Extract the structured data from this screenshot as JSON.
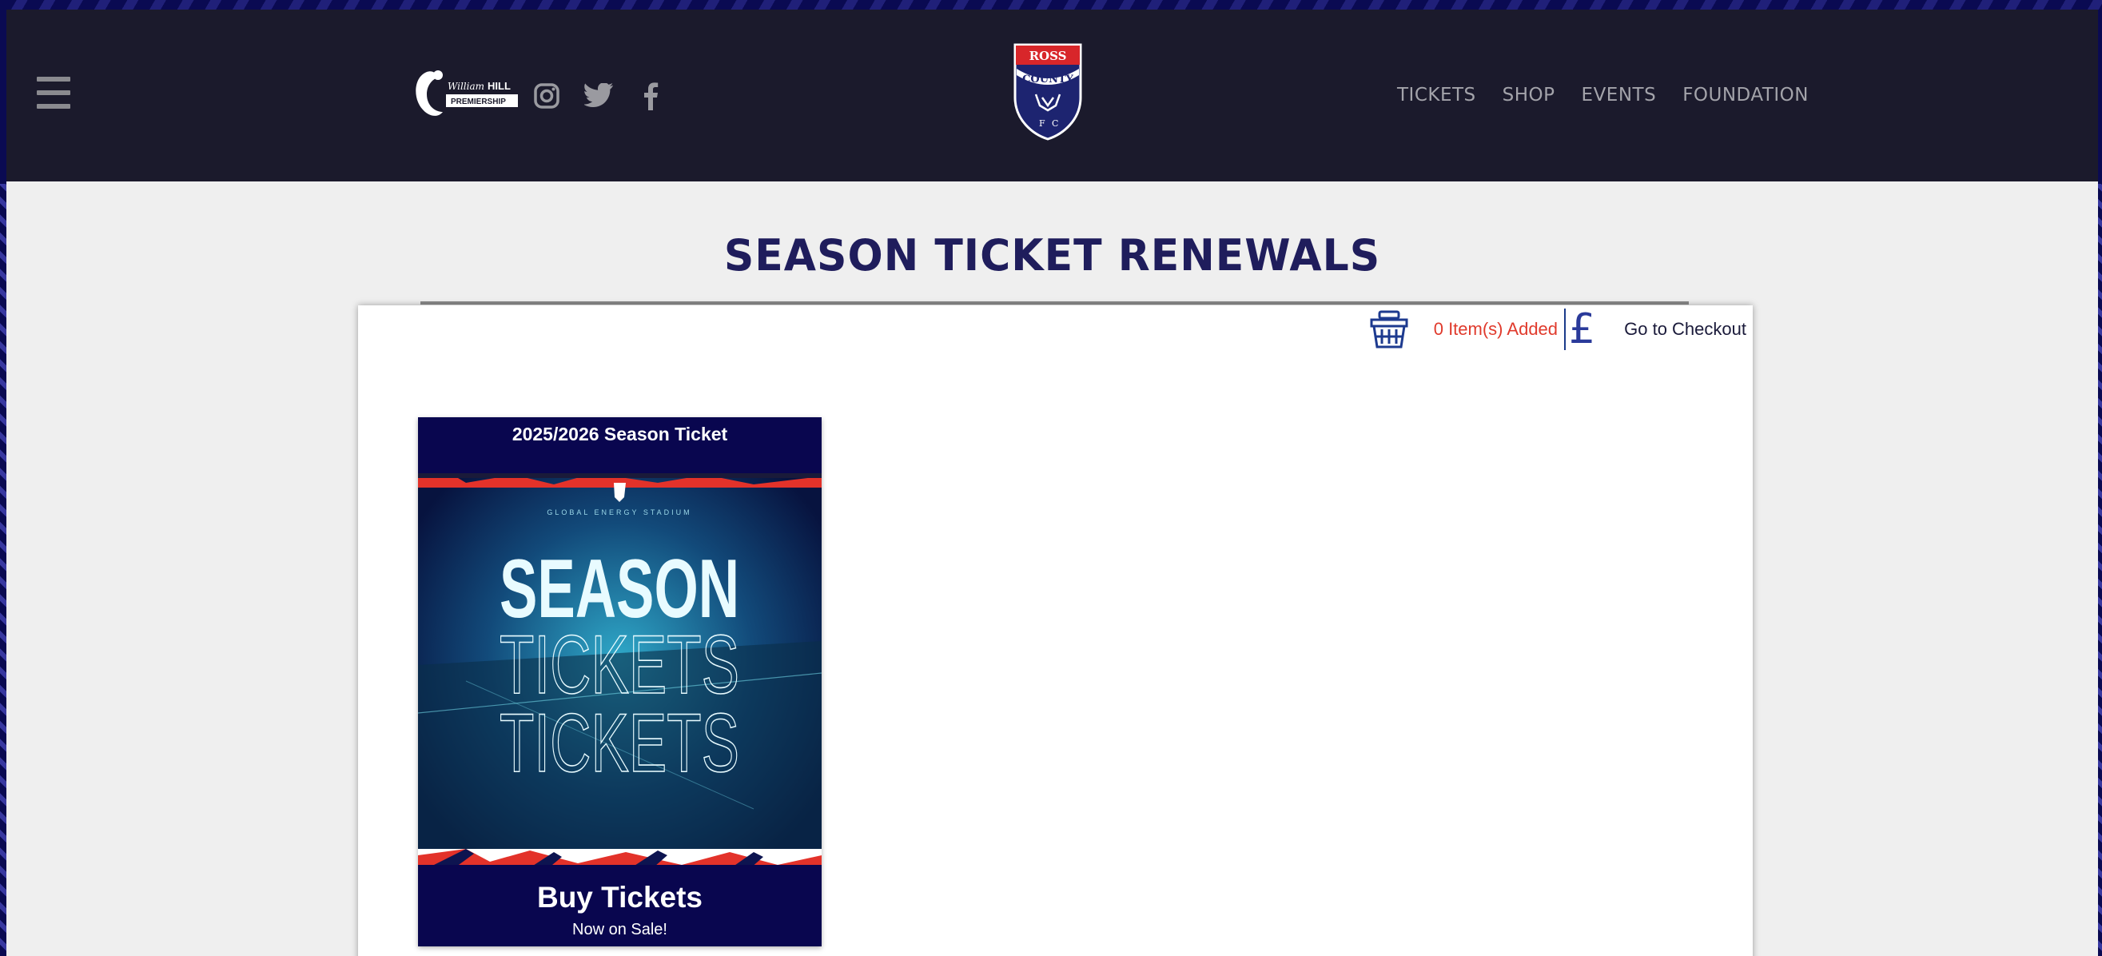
{
  "header": {
    "nav_items": [
      "TICKETS",
      "SHOP",
      "EVENTS",
      "FOUNDATION"
    ],
    "league_logo_text": "William HILL PREMIERSHIP",
    "crest_text": "ROSS COUNTY F.C."
  },
  "page": {
    "title": "SEASON TICKET RENEWALS"
  },
  "cart": {
    "items_added": "0 Item(s) Added",
    "currency_symbol": "£",
    "checkout_label": "Go to Checkout"
  },
  "product": {
    "title": "2025/2026 Season Ticket",
    "image_stadium": "GLOBAL ENERGY STADIUM",
    "image_line1": "SEASON",
    "image_line2": "TICKETS",
    "image_line3": "TICKETS",
    "buy_label": "Buy Tickets",
    "sale_label": "Now on Sale!"
  },
  "colors": {
    "header_bg": "#1b1a2c",
    "title": "#1f1d5c",
    "card_bg": "#09064f",
    "cart_red": "#e03a2c",
    "accent_red": "#e3322a"
  },
  "icons": [
    "hamburger-menu-icon",
    "instagram-icon",
    "twitter-icon",
    "facebook-icon",
    "basket-icon",
    "pound-icon"
  ]
}
